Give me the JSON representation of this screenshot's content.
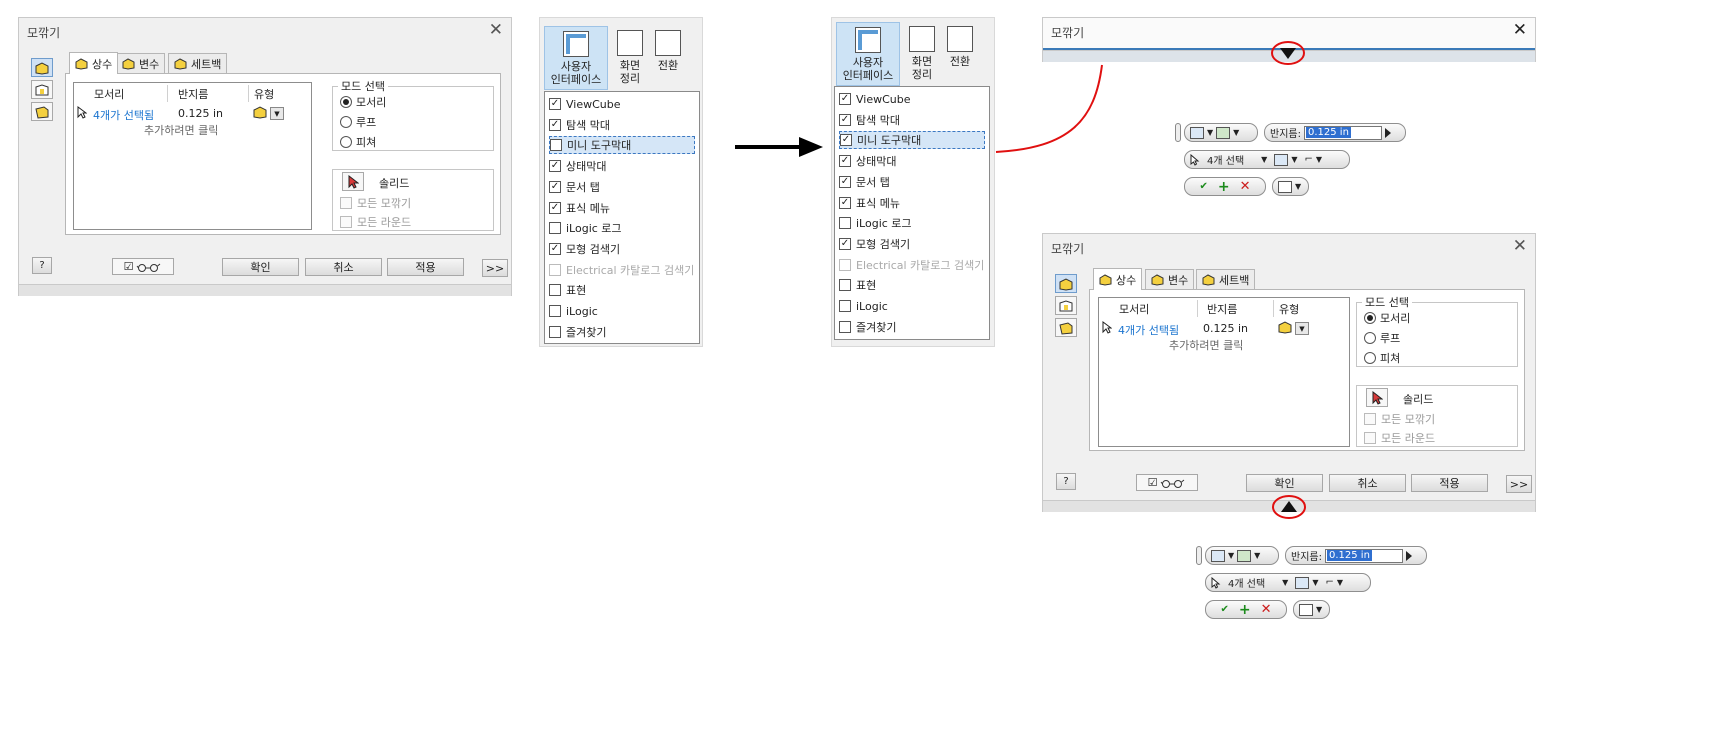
{
  "dialog": {
    "title": "모깎기",
    "close_glyph": "✕",
    "tabs": [
      "상수",
      "변수",
      "세트백"
    ],
    "table": {
      "headers": [
        "모서리",
        "반지름",
        "유형"
      ],
      "row": {
        "edges": "4개가 선택됨",
        "radius": "0.125 in"
      },
      "add_hint": "추가하려면 클릭"
    },
    "mode": {
      "label": "모드 선택",
      "options": [
        "모서리",
        "루프",
        "피쳐"
      ],
      "selected": "모서리"
    },
    "solid": {
      "label": "솔리드",
      "options": [
        "모든 모깎기",
        "모든 라운드"
      ]
    },
    "buttons": {
      "ok": "확인",
      "cancel": "취소",
      "apply": "적용",
      "more": ">>",
      "help": "?"
    }
  },
  "ribbon": {
    "user_interface": "사용자\n인터페이스",
    "arrange": "화면\n정리",
    "switch": "전환"
  },
  "menu_items": [
    {
      "label": "ViewCube",
      "checked": true,
      "disabled": false
    },
    {
      "label": "탐색 막대",
      "checked": true,
      "disabled": false
    },
    {
      "label": "미니 도구막대",
      "checked": false,
      "disabled": false
    },
    {
      "label": "상태막대",
      "checked": true,
      "disabled": false
    },
    {
      "label": "문서 탭",
      "checked": true,
      "disabled": false
    },
    {
      "label": "표식 메뉴",
      "checked": true,
      "disabled": false
    },
    {
      "label": "iLogic 로그",
      "checked": false,
      "disabled": false
    },
    {
      "label": "모형 검색기",
      "checked": true,
      "disabled": false
    },
    {
      "label": "Electrical 카탈로그 검색기",
      "checked": false,
      "disabled": true
    },
    {
      "label": "표현",
      "checked": false,
      "disabled": false
    },
    {
      "label": "iLogic",
      "checked": false,
      "disabled": false
    },
    {
      "label": "즐겨찾기",
      "checked": false,
      "disabled": false
    }
  ],
  "menu_items_after": [
    {
      "label": "ViewCube",
      "checked": true,
      "disabled": false
    },
    {
      "label": "탐색 막대",
      "checked": true,
      "disabled": false
    },
    {
      "label": "미니 도구막대",
      "checked": true,
      "disabled": false
    },
    {
      "label": "상태막대",
      "checked": true,
      "disabled": false
    },
    {
      "label": "문서 탭",
      "checked": true,
      "disabled": false
    },
    {
      "label": "표식 메뉴",
      "checked": true,
      "disabled": false
    },
    {
      "label": "iLogic 로그",
      "checked": false,
      "disabled": false
    },
    {
      "label": "모형 검색기",
      "checked": true,
      "disabled": false
    },
    {
      "label": "Electrical 카탈로그 검색기",
      "checked": false,
      "disabled": true
    },
    {
      "label": "표현",
      "checked": false,
      "disabled": false
    },
    {
      "label": "iLogic",
      "checked": false,
      "disabled": false
    },
    {
      "label": "즐겨찾기",
      "checked": false,
      "disabled": false
    }
  ],
  "mini_toolbar": {
    "radius_label": "반지름:",
    "radius_value": "0.125 in",
    "select_label": "4개 선택"
  },
  "colors": {
    "highlight_circle": "#e01010",
    "link": "#1b74cf"
  }
}
